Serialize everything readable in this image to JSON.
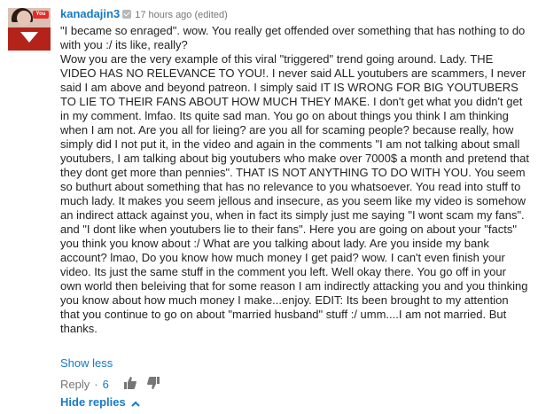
{
  "comment": {
    "author": "kanadajin3",
    "timestamp": "17 hours ago (edited)",
    "body": "\"I became so enraged\". wow. You really get offended over something that has nothing to do with you :/ its like, really?\nWow you are the very example of this viral \"triggered\" trend going around. Lady. THE VIDEO HAS NO RELEVANCE TO YOU!. I never said ALL youtubers are scammers, I never said I am above and beyond patreon. I simply said IT IS WRONG FOR BIG YOUTUBERS TO LIE TO THEIR FANS ABOUT HOW MUCH THEY MAKE. I don't get what you didn't get in my comment. lmfao. Its quite sad man. You go on about things you think I am thinking when I am not. Are you all for lieing? are you all for scaming people? because really, how simply did I not put it, in the video and again in the comments \"I am not talking about small youtubers, I am talking about big youtubers who make over 7000$ a month and pretend that they dont get more than pennies\". THAT IS NOT ANYTHING TO DO WITH YOU. You seem so buthurt about something that has no relevance to you whatsoever. You read into stuff to much lady. It makes you seem jellous and insecure, as you seem like my video is somehow an indirect attack against you, when in fact its simply just me saying \"I wont scam my fans\". and \"I dont like when youtubers lie to their fans\". Here you are going on about your \"facts\" you think you know about :/ What are you talking about lady. Are you inside my bank account? lmao, Do you know how much money I get paid? wow. I can't even finish your video. Its just the same stuff in the comment you left. Well okay there. You go off in your own world then beleiving that for some reason I am indirectly attacking you and you thinking you know about how much money I make...enjoy.   EDIT:  Its been brought to my attention that you continue to go on about \"married husband\" stuff :/ umm....I am not married. But thanks.",
    "show_less": "Show less",
    "reply": "Reply",
    "separator": "·",
    "like_count": "6",
    "hide_replies": "Hide replies"
  },
  "icons": {
    "verified": "verified-check-icon",
    "like": "thumbs-up-icon",
    "dislike": "thumbs-down-icon",
    "chevron": "chevron-up-icon"
  },
  "colors": {
    "link": "#167ac6",
    "text": "#222222",
    "muted": "#767676"
  }
}
